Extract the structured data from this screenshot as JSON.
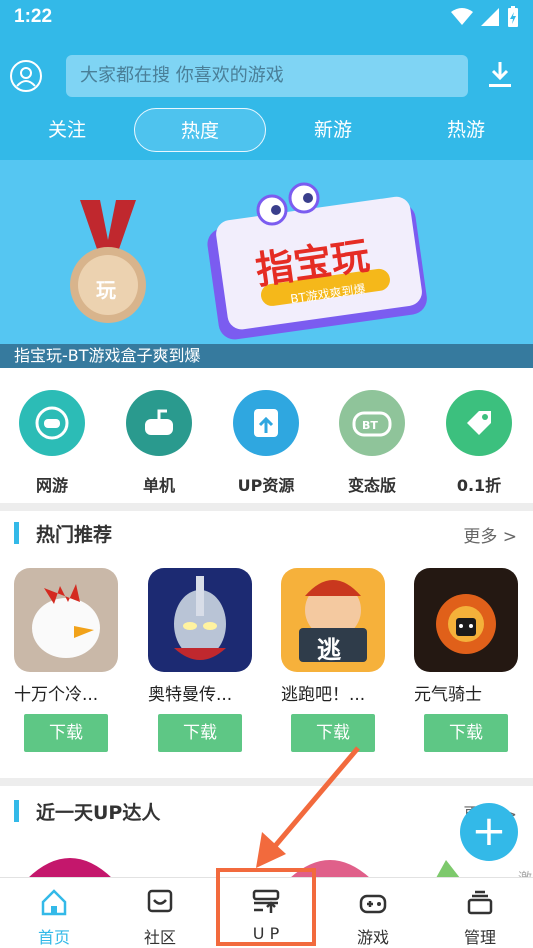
{
  "status": {
    "time": "1:22"
  },
  "search": {
    "placeholder": "大家都在搜 你喜欢的游戏"
  },
  "tabs": [
    "关注",
    "热度",
    "新游",
    "热游"
  ],
  "banner": {
    "title": "指宝玩",
    "subtitle": "BT游戏爽到爆",
    "caption": "指宝玩-BT游戏盒子爽到爆",
    "medal_text": "玩"
  },
  "categories": [
    {
      "label": "网游",
      "icon": "gamepad-icon",
      "color": "#2cbcb6"
    },
    {
      "label": "单机",
      "icon": "joystick-icon",
      "color": "#2a9a8e"
    },
    {
      "label": "UP资源",
      "icon": "upload-share-icon",
      "color": "#2fa7e0"
    },
    {
      "label": "变态版",
      "icon": "bt-gamepad-icon",
      "color": "#8fc49a"
    },
    {
      "label": "0.1折",
      "icon": "discount-tag-icon",
      "color": "#3cc07e"
    }
  ],
  "hot": {
    "title": "热门推荐",
    "more": "更多 >",
    "games": [
      {
        "name": "十万个冷...",
        "btn": "下载"
      },
      {
        "name": "奥特曼传...",
        "btn": "下载"
      },
      {
        "name": "逃跑吧！...",
        "btn": "下载",
        "icon_text": "逃"
      },
      {
        "name": "元气骑士",
        "btn": "下载"
      }
    ]
  },
  "up": {
    "title": "近一天UP达人",
    "more": "更多 >"
  },
  "side_text": [
    "激",
    "转"
  ],
  "fab": "+",
  "nav": [
    {
      "label": "首页",
      "icon": "home-icon"
    },
    {
      "label": "社区",
      "icon": "community-icon"
    },
    {
      "label": "U P",
      "icon": "up-icon"
    },
    {
      "label": "游戏",
      "icon": "game-controller-icon"
    },
    {
      "label": "管理",
      "icon": "manage-icon"
    }
  ],
  "colors": {
    "primary": "#33b9e8",
    "download": "#5ec785",
    "annotation": "#f26a3d"
  }
}
